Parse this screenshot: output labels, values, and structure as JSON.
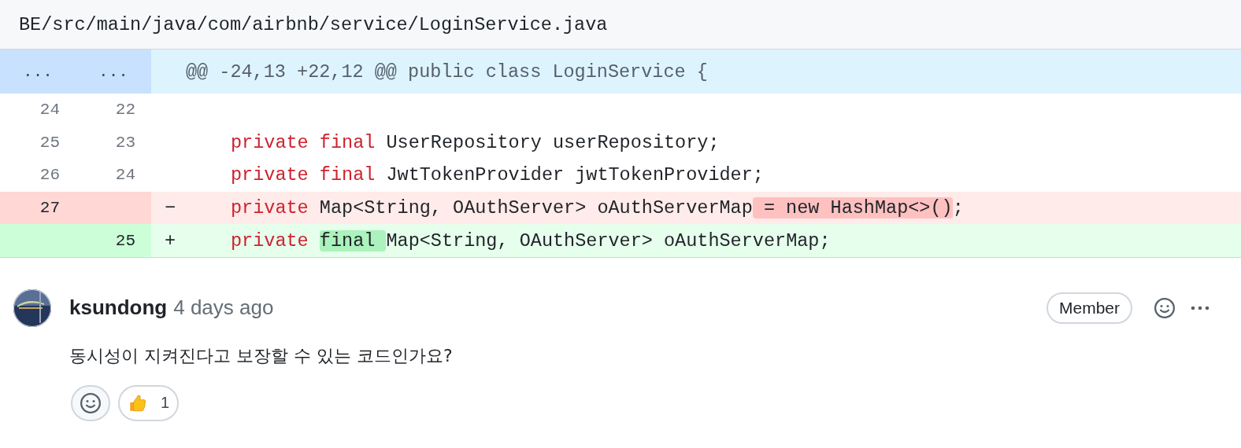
{
  "file": {
    "path": "BE/src/main/java/com/airbnb/service/LoginService.java"
  },
  "hunk": {
    "old_marker": "...",
    "new_marker": "...",
    "text": "@@ -24,13 +22,12 @@ public class LoginService {"
  },
  "lines": [
    {
      "kind": "context",
      "old": "24",
      "new": "22"
    },
    {
      "kind": "context",
      "old": "25",
      "new": "23",
      "segments": [
        {
          "kind": "keyword",
          "text": "private final"
        },
        {
          "kind": "plain",
          "text": " UserRepository userRepository;"
        }
      ]
    },
    {
      "kind": "context",
      "old": "26",
      "new": "24",
      "segments": [
        {
          "kind": "keyword",
          "text": "private final"
        },
        {
          "kind": "plain",
          "text": " JwtTokenProvider jwtTokenProvider;"
        }
      ]
    },
    {
      "kind": "removed",
      "old": "27",
      "sign": "−",
      "segments": [
        {
          "kind": "keyword",
          "text": "private"
        },
        {
          "kind": "plain",
          "text": " Map<String, OAuthServer> oAuthServerMap"
        },
        {
          "kind": "changed",
          "text": " = new HashMap<>()"
        },
        {
          "kind": "plain",
          "text": ";"
        }
      ]
    },
    {
      "kind": "added",
      "new": "25",
      "sign": "+",
      "segments": [
        {
          "kind": "keyword",
          "text": "private "
        },
        {
          "kind": "changed-keyword",
          "text": "final "
        },
        {
          "kind": "plain",
          "text": "Map<String, OAuthServer> oAuthServerMap;"
        }
      ]
    }
  ],
  "comment": {
    "author": "ksundong",
    "time": "4 days ago",
    "badge": "Member",
    "body": "동시성이 지켜진다고 보장할 수 있는 코드인가요?",
    "reactions": [
      {
        "kind": "add"
      },
      {
        "kind": "thumbs-up",
        "count": "1"
      }
    ]
  }
}
